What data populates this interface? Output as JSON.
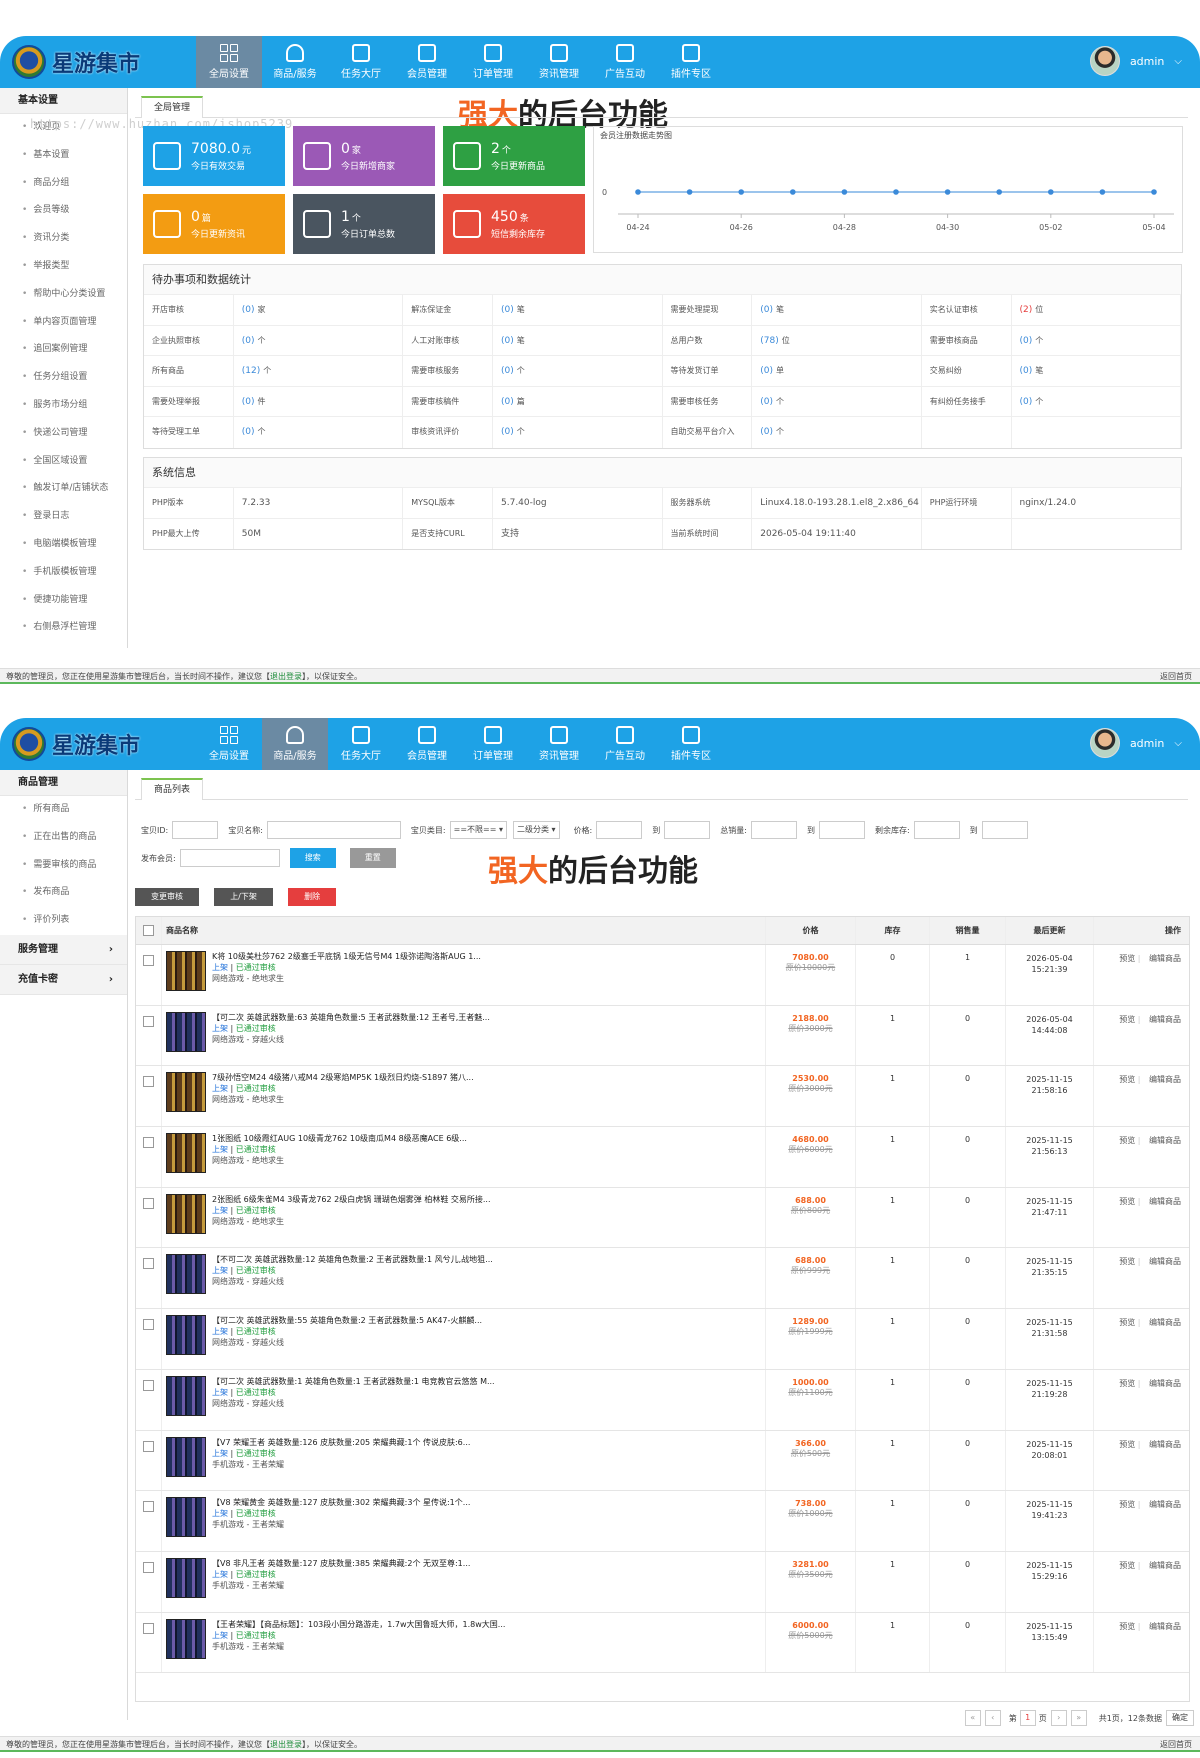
{
  "colors": {
    "header": "#1ea2e6",
    "nav_active": "#6b8aa3",
    "accent_green": "#7cc34f",
    "price": "#f26522",
    "link": "#3b8ad9"
  },
  "brand": "星游集市",
  "banner": {
    "highlight": "强大",
    "rest": "的后台功能"
  },
  "watermark": "https://www.huzhan.com/ishop5239",
  "nav": [
    {
      "label": "全局设置",
      "icon": "grid-icon"
    },
    {
      "label": "商品/服务",
      "icon": "person-icon"
    },
    {
      "label": "任务大厅",
      "icon": "copy-icon"
    },
    {
      "label": "会员管理",
      "icon": "list-icon"
    },
    {
      "label": "订单管理",
      "icon": "camera-icon"
    },
    {
      "label": "资讯管理",
      "icon": "calendar-icon"
    },
    {
      "label": "广告互动",
      "icon": "gear-icon"
    },
    {
      "label": "插件专区",
      "icon": "bag-icon"
    }
  ],
  "user": {
    "name": "admin"
  },
  "panel1": {
    "sidebar_head": "基本设置",
    "sidebar": [
      "欢迎页",
      "基本设置",
      "商品分组",
      "会员等级",
      "资讯分类",
      "举报类型",
      "帮助中心分类设置",
      "单内容页面管理",
      "追回案例管理",
      "任务分组设置",
      "服务市场分组",
      "快递公司管理",
      "全国区域设置",
      "触发订单/店铺状态",
      "登录日志",
      "电脑端模板管理",
      "手机版模板管理",
      "便捷功能管理",
      "右侧悬浮栏管理"
    ],
    "tab": "全局管理",
    "tiles": [
      {
        "num": "7080.0",
        "unit": "元",
        "label": "今日有效交易",
        "color": "#1ea2e6",
        "icon": "yen-icon"
      },
      {
        "num": "0",
        "unit": "家",
        "label": "今日新增商家",
        "color": "#9b59b6",
        "icon": "doc-icon"
      },
      {
        "num": "2",
        "unit": "个",
        "label": "今日更新商品",
        "color": "#2ea043",
        "icon": "book-icon"
      },
      {
        "num": "0",
        "unit": "篇",
        "label": "今日更新资讯",
        "color": "#f39c12",
        "icon": "mail-icon"
      },
      {
        "num": "1",
        "unit": "个",
        "label": "今日订单总数",
        "color": "#4a5560",
        "icon": "hand-icon"
      },
      {
        "num": "450",
        "unit": "条",
        "label": "短信剩余库存",
        "color": "#e74c3c",
        "icon": "alert-icon"
      }
    ],
    "chart_title": "会员注册数据走势图",
    "pending": {
      "title": "待办事项和数据统计",
      "rows": [
        [
          [
            "开店审核",
            "(0)",
            "家"
          ],
          [
            "解冻保证金",
            "(0)",
            "笔"
          ],
          [
            "需要处理提现",
            "(0)",
            "笔"
          ],
          [
            "实名认证审核",
            "(2)",
            "位"
          ]
        ],
        [
          [
            "企业执照审核",
            "(0)",
            "个"
          ],
          [
            "人工对账审核",
            "(0)",
            "笔"
          ],
          [
            "总用户数",
            "(78)",
            "位"
          ],
          [
            "需要审核商品",
            "(0)",
            "个"
          ]
        ],
        [
          [
            "所有商品",
            "(12)",
            "个"
          ],
          [
            "需要审核服务",
            "(0)",
            "个"
          ],
          [
            "等待发货订单",
            "(0)",
            "单"
          ],
          [
            "交易纠纷",
            "(0)",
            "笔"
          ]
        ],
        [
          [
            "需要处理举报",
            "(0)",
            "件"
          ],
          [
            "需要审核稿件",
            "(0)",
            "篇"
          ],
          [
            "需要审核任务",
            "(0)",
            "个"
          ],
          [
            "有纠纷任务接手",
            "(0)",
            "个"
          ]
        ],
        [
          [
            "等待受理工单",
            "(0)",
            "个"
          ],
          [
            "审核资讯评价",
            "(0)",
            "个"
          ],
          [
            "自助交易平台介入",
            "(0)",
            "个"
          ],
          [
            "",
            "",
            " "
          ]
        ]
      ]
    },
    "sysinfo": {
      "title": "系统信息",
      "rows": [
        [
          [
            "PHP版本",
            "7.2.33"
          ],
          [
            "MYSQL版本",
            "5.7.40-log"
          ],
          [
            "服务器系统",
            "Linux4.18.0-193.28.1.el8_2.x86_64"
          ],
          [
            "PHP运行环境",
            "nginx/1.24.0"
          ]
        ],
        [
          [
            "PHP最大上传",
            "50M"
          ],
          [
            "是否支持CURL",
            "支持"
          ],
          [
            "当前系统时间",
            "2026-05-04 19:11:40"
          ],
          [
            "",
            ""
          ]
        ]
      ]
    },
    "footer": {
      "pre": "尊敬的管理员，您正在使用星游集市管理后台，当长时间不操作，建议您【",
      "link": "退出登录",
      "post": "】，以保证安全。",
      "right": "返回首页"
    }
  },
  "chart_data": {
    "type": "line",
    "title": "会员注册数据走势图",
    "x": [
      "04-24",
      "04-25",
      "04-26",
      "04-27",
      "04-28",
      "04-29",
      "04-30",
      "05-01",
      "05-02",
      "05-03",
      "05-04"
    ],
    "tick_labels": [
      "04-24",
      "04-26",
      "04-28",
      "04-30",
      "05-02",
      "05-04"
    ],
    "values": [
      0,
      0,
      0,
      0,
      0,
      0,
      0,
      0,
      0,
      0,
      0
    ],
    "yticks": [
      "0"
    ],
    "grid": false
  },
  "panel2": {
    "sidebar_head": "商品管理",
    "sidebar": [
      "所有商品",
      "正在出售的商品",
      "需要审核的商品",
      "发布商品",
      "评价列表"
    ],
    "sidebar_groups": [
      "服务管理",
      "充值卡密"
    ],
    "tab": "商品列表",
    "filter": {
      "id": "宝贝ID:",
      "name": "宝贝名称:",
      "cat": "宝贝类目:",
      "cat_sel": "==不限==",
      "cat2_sel": "二级分类",
      "price": "价格:",
      "to": "到",
      "sales": "总销量:",
      "stock": "剩余库存:",
      "publisher": "发布会员:",
      "search": "搜索",
      "reset": "重置"
    },
    "actions": [
      "变更审核",
      "上/下架",
      "删除"
    ],
    "headers": [
      "商品名称",
      "价格",
      "库存",
      "销售量",
      "最后更新",
      "操作"
    ],
    "rows": [
      {
        "name": "K将 10级美杜莎762 2级塞壬平底锅 1级无信号M4 1级弥诺陶洛斯AUG 1...",
        "price": "7080.00",
        "orig": "原价10000元",
        "stock": "0",
        "sales": "1",
        "date": "2026-05-04",
        "time": "15:21:39",
        "cat": "网络游戏 - 绝地求生",
        "blue": false
      },
      {
        "name": "【可二次 英雄武器数量:63 英雄角色数量:5 王者武器数量:12 王者号,王者魅...",
        "price": "2188.00",
        "orig": "原价3000元",
        "stock": "1",
        "sales": "0",
        "date": "2026-05-04",
        "time": "14:44:08",
        "cat": "网络游戏 - 穿越火线",
        "blue": true
      },
      {
        "name": "7级孙悟空M24 4级猪八戒M4 2级寒焰MP5K 1级烈日灼烧-S1897 猪八...",
        "price": "2530.00",
        "orig": "原价3000元",
        "stock": "1",
        "sales": "0",
        "date": "2025-11-15",
        "time": "21:58:16",
        "cat": "网络游戏 - 绝地求生",
        "blue": false
      },
      {
        "name": "1张图纸 10级霞红AUG 10级青龙762 10级南瓜M4 8级恶魔ACE 6级...",
        "price": "4680.00",
        "orig": "原价6000元",
        "stock": "1",
        "sales": "0",
        "date": "2025-11-15",
        "time": "21:56:13",
        "cat": "网络游戏 - 绝地求生",
        "blue": false
      },
      {
        "name": "2张图纸 6级朱雀M4 3级青龙762 2级白虎锅 珊瑚色烟雾弹 柏林鞋 交易所接...",
        "price": "688.00",
        "orig": "原价800元",
        "stock": "1",
        "sales": "0",
        "date": "2025-11-15",
        "time": "21:47:11",
        "cat": "网络游戏 - 绝地求生",
        "blue": false
      },
      {
        "name": "【不可二次 英雄武器数量:12 英雄角色数量:2 王者武器数量:1 风兮儿,战地狙...",
        "price": "688.00",
        "orig": "原价999元",
        "stock": "1",
        "sales": "0",
        "date": "2025-11-15",
        "time": "21:35:15",
        "cat": "网络游戏 - 穿越火线",
        "blue": true
      },
      {
        "name": "【可二次 英雄武器数量:55 英雄角色数量:2 王者武器数量:5 AK47-火麒麟...",
        "price": "1289.00",
        "orig": "原价1999元",
        "stock": "1",
        "sales": "0",
        "date": "2025-11-15",
        "time": "21:31:58",
        "cat": "网络游戏 - 穿越火线",
        "blue": true
      },
      {
        "name": "【可二次 英雄武器数量:1 英雄角色数量:1 王者武器数量:1 电竞教官云悠悠 M...",
        "price": "1000.00",
        "orig": "原价1100元",
        "stock": "1",
        "sales": "0",
        "date": "2025-11-15",
        "time": "21:19:28",
        "cat": "网络游戏 - 穿越火线",
        "blue": true
      },
      {
        "name": "【V7 荣耀王者 英雄数量:126 皮肤数量:205 荣耀典藏:1个 传说皮肤:6...",
        "price": "366.00",
        "orig": "原价500元",
        "stock": "1",
        "sales": "0",
        "date": "2025-11-15",
        "time": "20:08:01",
        "cat": "手机游戏 - 王者荣耀",
        "blue": true
      },
      {
        "name": "【V8 荣耀黄金 英雄数量:127 皮肤数量:302 荣耀典藏:3个 星传说:1个...",
        "price": "738.00",
        "orig": "原价1000元",
        "stock": "1",
        "sales": "0",
        "date": "2025-11-15",
        "time": "19:41:23",
        "cat": "手机游戏 - 王者荣耀",
        "blue": true
      },
      {
        "name": "【V8 非凡王者 英雄数量:127 皮肤数量:385 荣耀典藏:2个 无双至尊:1...",
        "price": "3281.00",
        "orig": "原价3500元",
        "stock": "1",
        "sales": "0",
        "date": "2025-11-15",
        "time": "15:29:16",
        "cat": "手机游戏 - 王者荣耀",
        "blue": true
      },
      {
        "name": "【王者荣耀】【商品标题】：103段小国分路游走，1.7w大国鲁班大师，1.8w大国...",
        "price": "6000.00",
        "orig": "原价5000元",
        "stock": "1",
        "sales": "0",
        "date": "2025-11-15",
        "time": "13:15:49",
        "cat": "手机游戏 - 王者荣耀",
        "blue": true
      }
    ],
    "row_status": {
      "up": "上架",
      "ok": "已通过审核",
      "sep": " | "
    },
    "row_ops": {
      "preview": "预览",
      "edit": "编辑商品"
    },
    "pager": {
      "first": "第",
      "page": "1",
      "page_unit": "页",
      "total": "共1页，12条数据",
      "go": "确定"
    }
  }
}
